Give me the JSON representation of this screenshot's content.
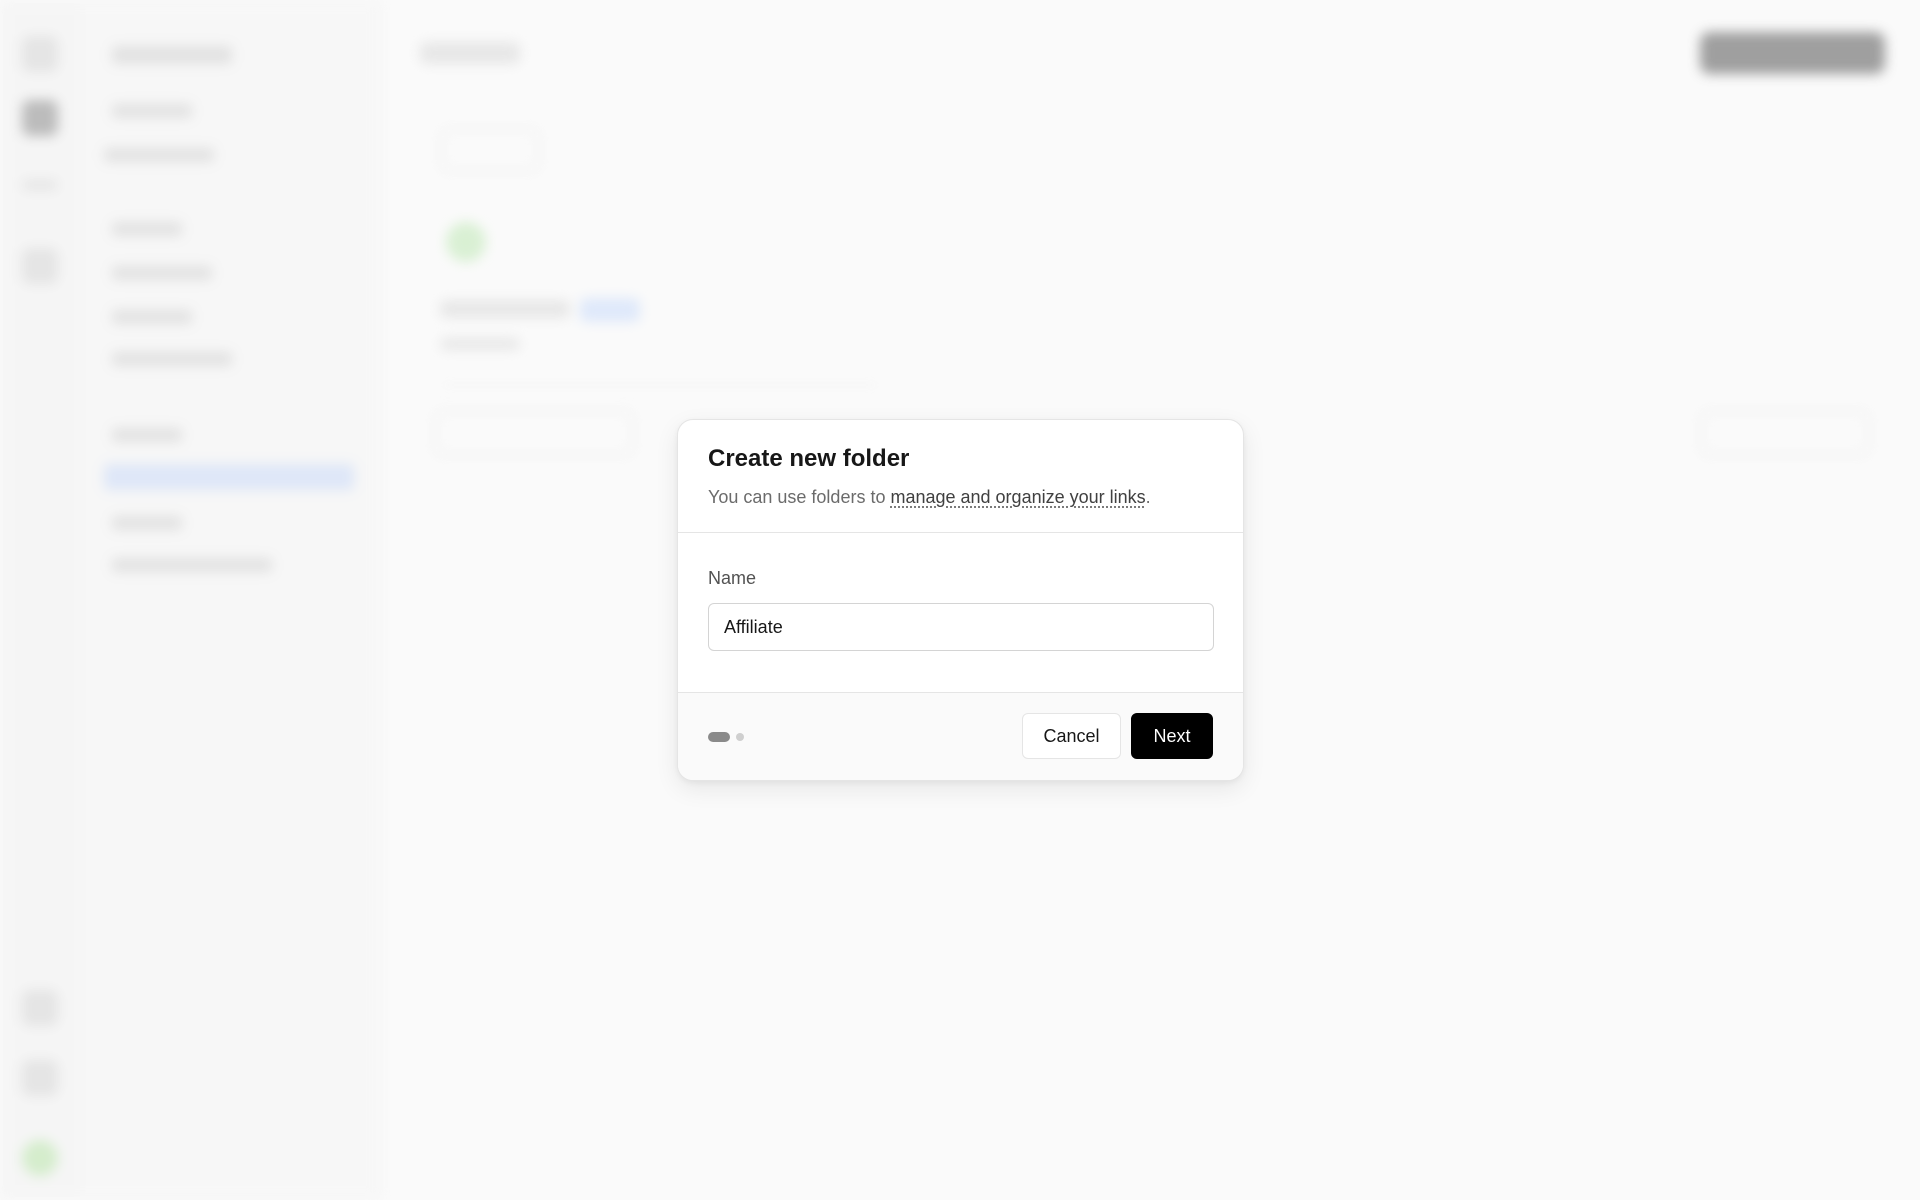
{
  "modal": {
    "title": "Create new folder",
    "description_prefix": "You can use folders to ",
    "description_link": "manage and organize your links",
    "description_suffix": ".",
    "name_label": "Name",
    "name_value": "Affiliate",
    "cancel_label": "Cancel",
    "next_label": "Next",
    "current_step": 1,
    "total_steps": 2
  }
}
